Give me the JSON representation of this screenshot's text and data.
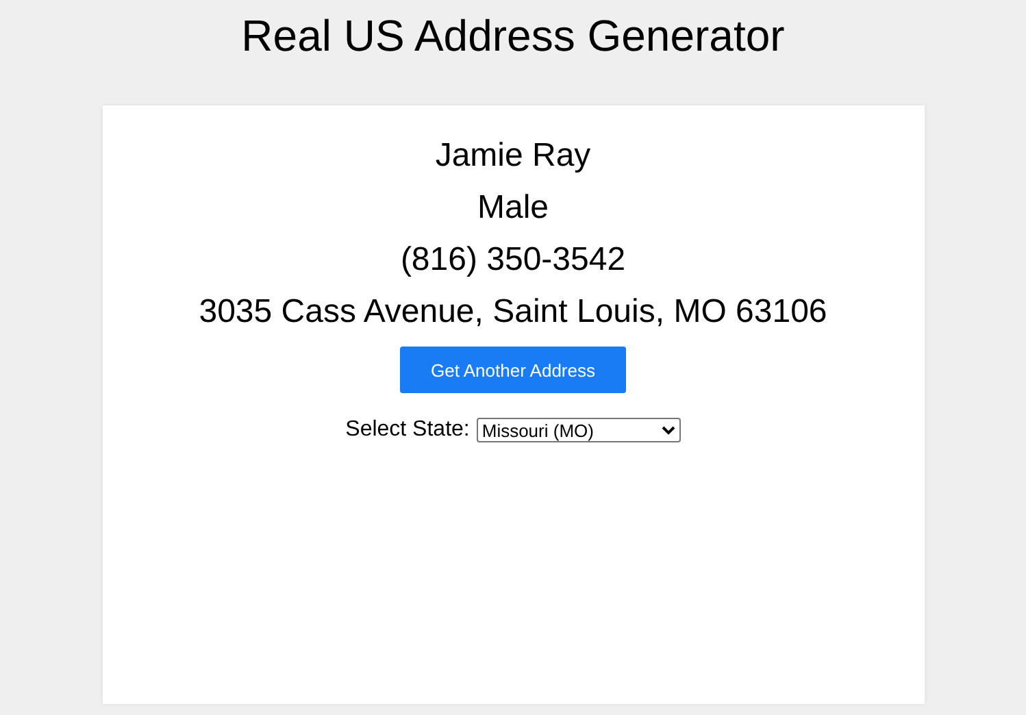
{
  "title": "Real US Address Generator",
  "person": {
    "name": "Jamie Ray",
    "gender": "Male",
    "phone": "(816) 350-3542",
    "address": "3035 Cass Avenue, Saint Louis, MO 63106"
  },
  "button": {
    "label": "Get Another Address"
  },
  "state_select": {
    "label": "Select State:",
    "value": "Missouri (MO)"
  }
}
